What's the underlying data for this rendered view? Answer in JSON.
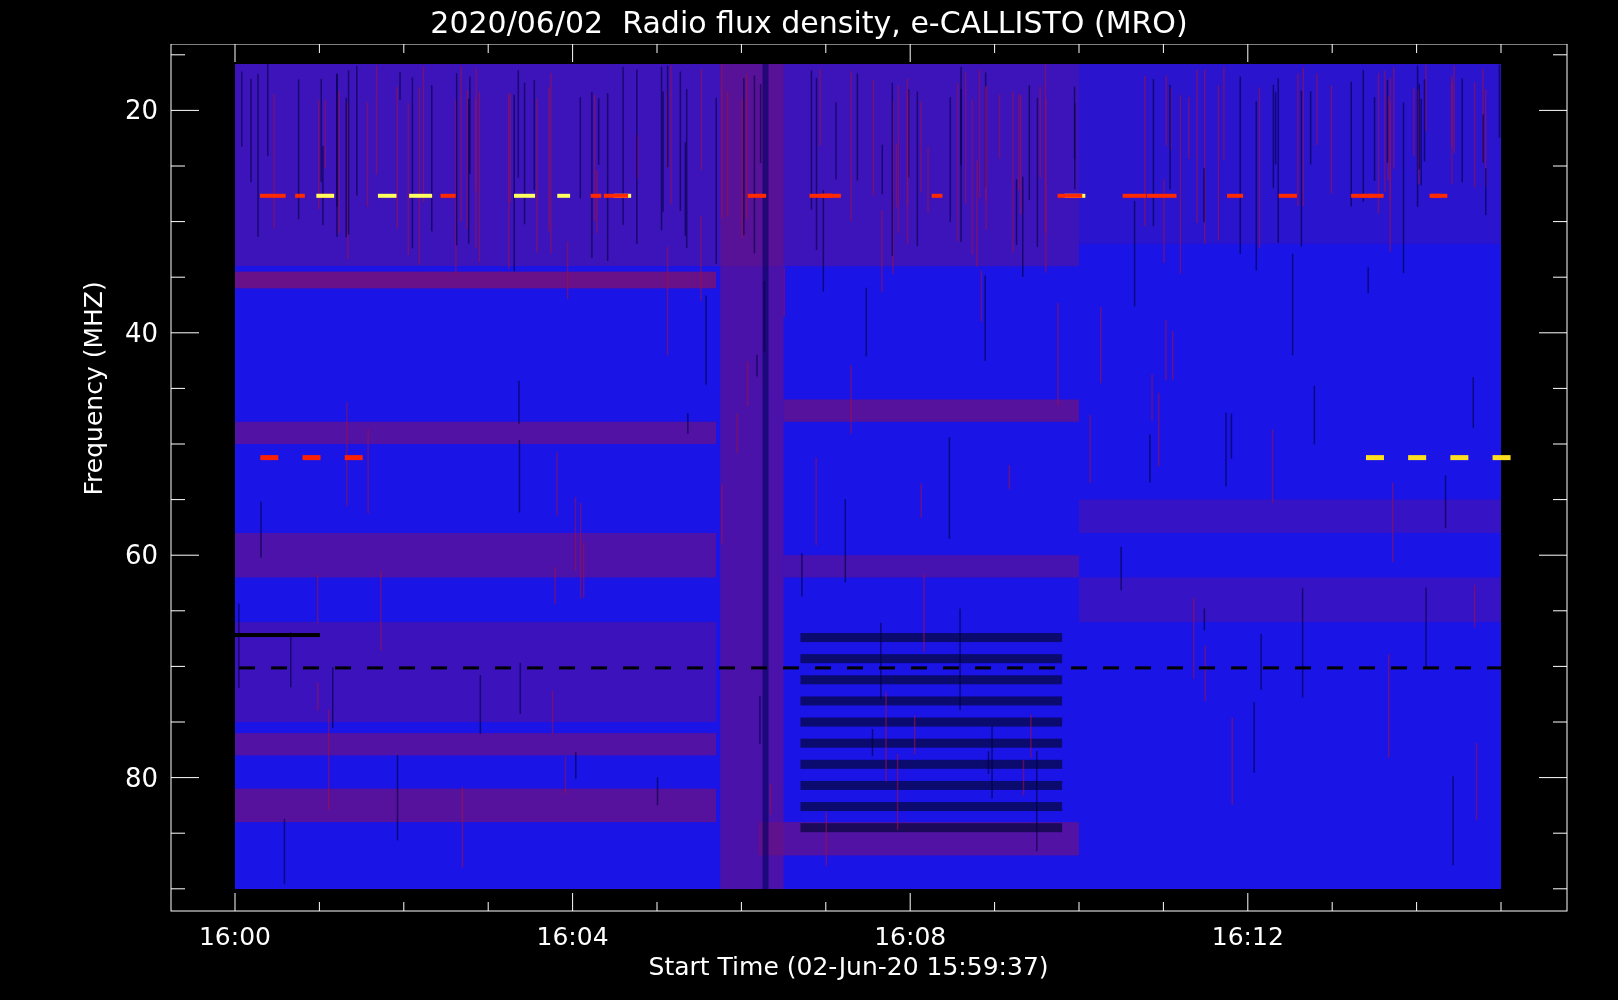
{
  "title": "2020/06/02  Radio flux density, e-CALLISTO (MRO)",
  "y_axis": {
    "label": "Frequency (MHZ)",
    "ticks": [
      "20",
      "40",
      "60",
      "80"
    ]
  },
  "x_axis": {
    "label": "Start Time (02-Jun-20 15:59:37)",
    "ticks": [
      "16:00",
      "16:04",
      "16:08",
      "16:12"
    ]
  }
}
